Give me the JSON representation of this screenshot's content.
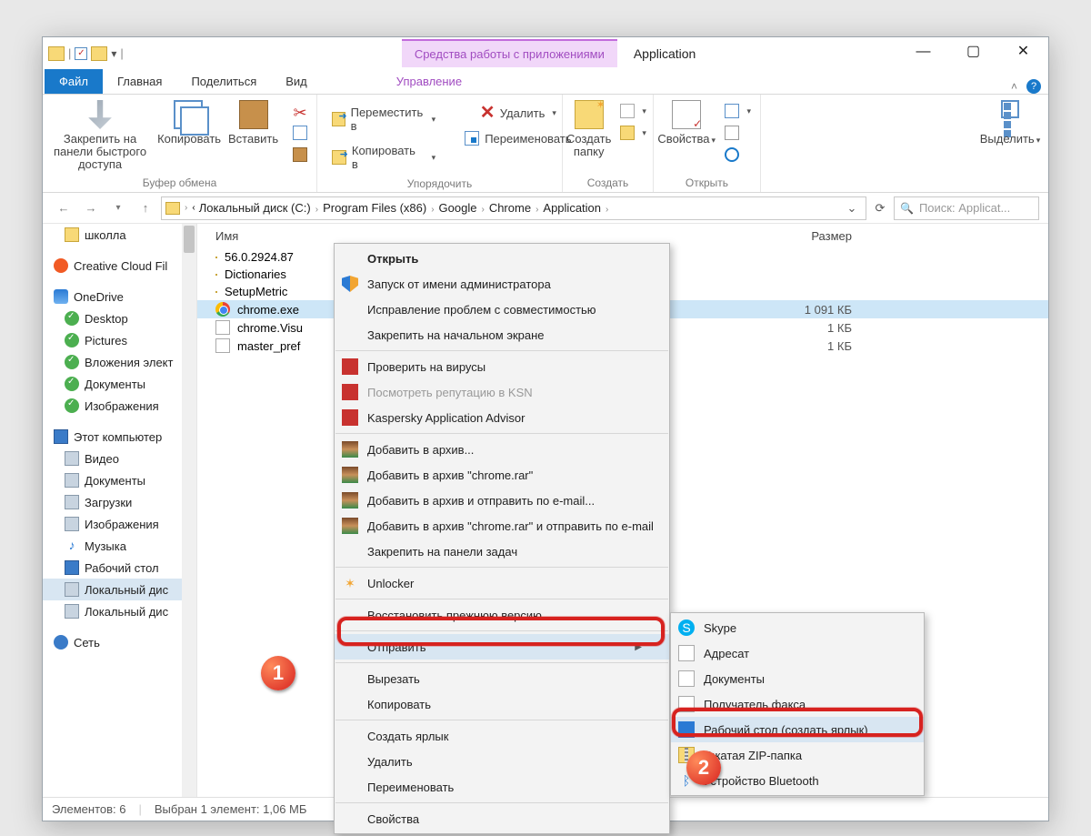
{
  "title_context": "Средства работы с приложениями",
  "title": "Application",
  "tabs": {
    "file": "Файл",
    "home": "Главная",
    "share": "Поделиться",
    "view": "Вид",
    "manage": "Управление"
  },
  "ribbon": {
    "clipboard": {
      "pin": "Закрепить на панели быстрого доступа",
      "copy": "Копировать",
      "paste": "Вставить",
      "label": "Буфер обмена"
    },
    "organize": {
      "move": "Переместить в",
      "copyto": "Копировать в",
      "del": "Удалить",
      "ren": "Переименовать",
      "label": "Упорядочить"
    },
    "create": {
      "new": "Создать папку",
      "label": "Создать"
    },
    "open": {
      "props": "Свойства",
      "label": "Открыть"
    },
    "select": {
      "sel": "Выделить"
    }
  },
  "breadcrumbs": [
    "Локальный диск (C:)",
    "Program Files (x86)",
    "Google",
    "Chrome",
    "Application"
  ],
  "search_placeholder": "Поиск: Applicat...",
  "columns": {
    "name": "Имя",
    "size": "Размер"
  },
  "sidebar": [
    {
      "label": "школла",
      "icon": "folder",
      "lvl": 2
    },
    {
      "label": "Creative Cloud Fil",
      "icon": "cc",
      "lvl": 1,
      "gap": true
    },
    {
      "label": "OneDrive",
      "icon": "od",
      "lvl": 1,
      "gap": true
    },
    {
      "label": "Desktop",
      "icon": "green",
      "lvl": 2
    },
    {
      "label": "Pictures",
      "icon": "green",
      "lvl": 2
    },
    {
      "label": "Вложения элект",
      "icon": "green",
      "lvl": 2
    },
    {
      "label": "Документы",
      "icon": "green",
      "lvl": 2
    },
    {
      "label": "Изображения",
      "icon": "green",
      "lvl": 2
    },
    {
      "label": "Этот компьютер",
      "icon": "pc",
      "lvl": 1,
      "gap": true
    },
    {
      "label": "Видео",
      "icon": "disk",
      "lvl": 2
    },
    {
      "label": "Документы",
      "icon": "disk",
      "lvl": 2
    },
    {
      "label": "Загрузки",
      "icon": "disk",
      "lvl": 2
    },
    {
      "label": "Изображения",
      "icon": "disk",
      "lvl": 2
    },
    {
      "label": "Музыка",
      "icon": "music",
      "lvl": 2
    },
    {
      "label": "Рабочий стол",
      "icon": "desk",
      "lvl": 2
    },
    {
      "label": "Локальный дис",
      "icon": "disk",
      "lvl": 2,
      "sel": true
    },
    {
      "label": "Локальный дис",
      "icon": "disk",
      "lvl": 2
    },
    {
      "label": "Сеть",
      "icon": "net",
      "lvl": 1,
      "gap": true
    }
  ],
  "files": [
    {
      "name": "56.0.2924.87",
      "icon": "folder",
      "size": ""
    },
    {
      "name": "Dictionaries",
      "icon": "folder",
      "size": ""
    },
    {
      "name": "SetupMetric",
      "icon": "folder",
      "size": ""
    },
    {
      "name": "chrome.exe",
      "icon": "chrome",
      "size": "1 091 КБ",
      "sel": true
    },
    {
      "name": "chrome.Visu",
      "icon": "file",
      "size": "1 КБ"
    },
    {
      "name": "master_pref",
      "icon": "file",
      "size": "1 КБ"
    }
  ],
  "ctx1": [
    {
      "t": "Открыть",
      "bold": true
    },
    {
      "t": "Запуск от имени администратора",
      "ic": "shield"
    },
    {
      "t": "Исправление проблем с совместимостью"
    },
    {
      "t": "Закрепить на начальном экране"
    },
    {
      "sep": true
    },
    {
      "t": "Проверить на вирусы",
      "ic": "kasp"
    },
    {
      "t": "Посмотреть репутацию в KSN",
      "ic": "kasp",
      "dis": true
    },
    {
      "t": "Kaspersky Application Advisor",
      "ic": "kasp"
    },
    {
      "sep": true
    },
    {
      "t": "Добавить в архив...",
      "ic": "rar"
    },
    {
      "t": "Добавить в архив \"chrome.rar\"",
      "ic": "rar"
    },
    {
      "t": "Добавить в архив и отправить по e-mail...",
      "ic": "rar"
    },
    {
      "t": "Добавить в архив \"chrome.rar\" и отправить по e-mail",
      "ic": "rar"
    },
    {
      "t": "Закрепить на панели задач"
    },
    {
      "sep": true
    },
    {
      "t": "Unlocker",
      "ic": "unl"
    },
    {
      "sep": true
    },
    {
      "t": "Восстановить прежнюю версию"
    },
    {
      "sep": true
    },
    {
      "t": "Отправить",
      "sub": true,
      "hover": true
    },
    {
      "sep": true
    },
    {
      "t": "Вырезать"
    },
    {
      "t": "Копировать"
    },
    {
      "sep": true
    },
    {
      "t": "Создать ярлык"
    },
    {
      "t": "Удалить"
    },
    {
      "t": "Переименовать"
    },
    {
      "sep": true
    },
    {
      "t": "Свойства"
    }
  ],
  "ctx2": [
    {
      "t": "Skype",
      "ic": "skype"
    },
    {
      "t": "Адресат",
      "ic": "file"
    },
    {
      "t": "Документы",
      "ic": "file"
    },
    {
      "t": "Получатель факса",
      "ic": "file"
    },
    {
      "t": "Рабочий стол (создать ярлык)",
      "ic": "desk",
      "hover": true
    },
    {
      "t": "Сжатая ZIP-папка",
      "ic": "zip"
    },
    {
      "t": "Устройство Bluetooth",
      "ic": "bt"
    }
  ],
  "status": {
    "items": "Элементов: 6",
    "sel": "Выбран 1 элемент: 1,06 МБ"
  }
}
